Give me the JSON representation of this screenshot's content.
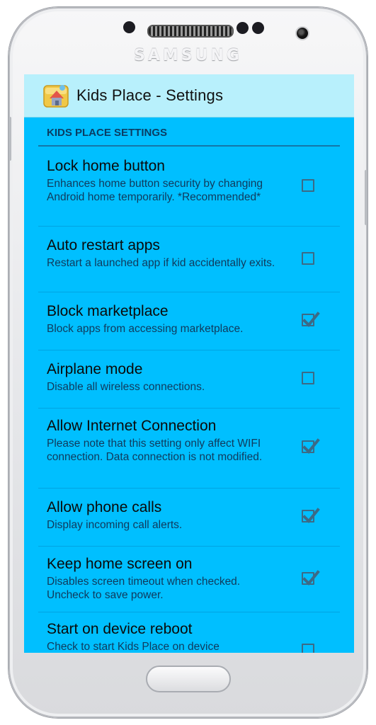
{
  "device": {
    "brand": "SAMSUNG"
  },
  "app": {
    "title": "Kids Place - Settings",
    "icon": "kids-place-house-icon"
  },
  "section": {
    "header": "KIDS PLACE SETTINGS"
  },
  "colors": {
    "screen_bg": "#00bfff",
    "appbar_bg": "#b8f0fc",
    "divider": "#1476a8"
  },
  "preferences": [
    {
      "title": "Lock home button",
      "summary": "Enhances home button security by changing Android home temporarily. *Recommended*",
      "checked": false
    },
    {
      "title": "Auto restart apps",
      "summary": "Restart a launched app if kid accidentally exits.",
      "checked": false
    },
    {
      "title": "Block marketplace",
      "summary": "Block apps from accessing marketplace.",
      "checked": true
    },
    {
      "title": "Airplane mode",
      "summary": "Disable all wireless connections.",
      "checked": false
    },
    {
      "title": "Allow Internet Connection",
      "summary": "Please note that this setting only affect WIFI connection. Data connection is not modified.",
      "checked": true
    },
    {
      "title": "Allow phone calls",
      "summary": "Display incoming call alerts.",
      "checked": true
    },
    {
      "title": "Keep home screen on",
      "summary": "Disables screen timeout when checked. Uncheck to save power.",
      "checked": true
    },
    {
      "title": "Start on device reboot",
      "summary": "Check to start Kids Place on device",
      "checked": false
    }
  ]
}
